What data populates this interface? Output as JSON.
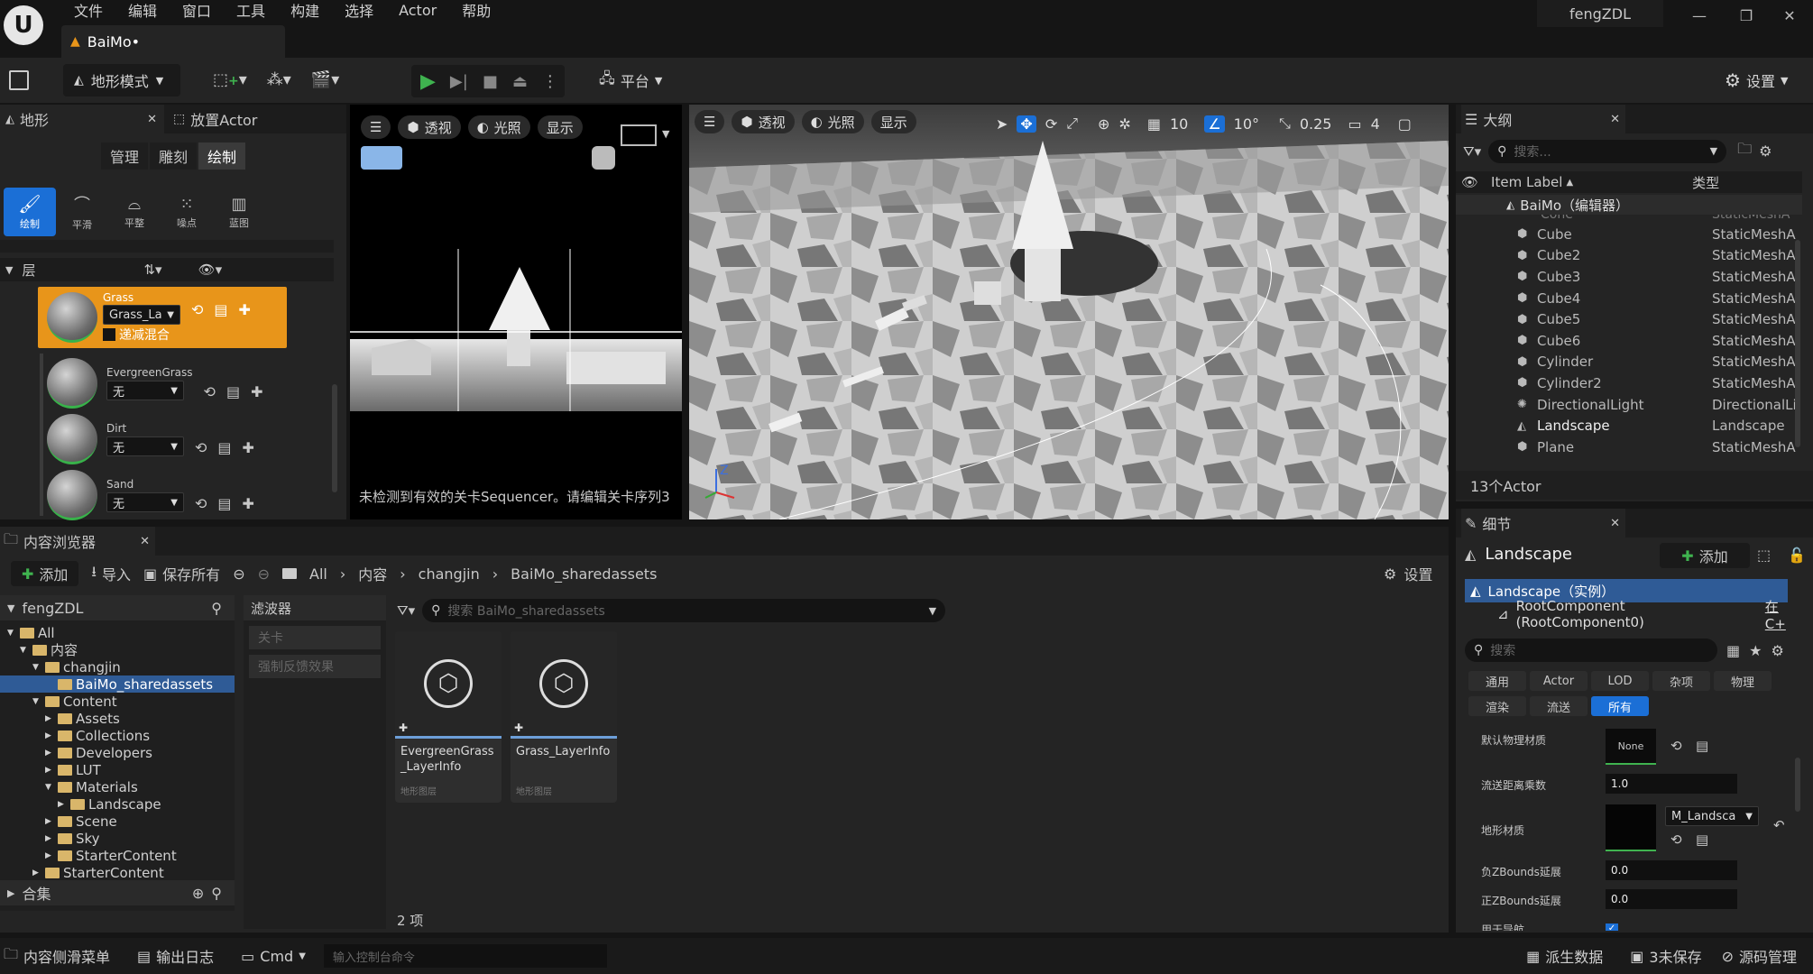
{
  "menu": [
    "文件",
    "编辑",
    "窗口",
    "工具",
    "构建",
    "选择",
    "Actor",
    "帮助"
  ],
  "document_tab": "BaiMo•",
  "user": "fengZDL",
  "window_controls": {
    "minimize": "—",
    "restore": "❐",
    "close": "✕"
  },
  "toolbar": {
    "mode": "地形模式",
    "platform": "平台",
    "settings": "设置"
  },
  "landscape_panel": {
    "tabs": [
      "地形",
      "放置Actor"
    ],
    "modes": [
      "管理",
      "雕刻",
      "绘制"
    ],
    "active_mode": "绘制",
    "tools": [
      "绘制",
      "平滑",
      "平整",
      "噪点",
      "蓝图"
    ],
    "layer_section": "层",
    "layers": [
      {
        "name": "Grass",
        "info": "Grass_La",
        "blend": "递减混合",
        "selected": true
      },
      {
        "name": "EvergreenGrass",
        "info": "无"
      },
      {
        "name": "Dirt",
        "info": "无"
      },
      {
        "name": "Sand",
        "info": "无"
      }
    ]
  },
  "viewport_left": {
    "buttons": [
      "透视",
      "光照",
      "显示"
    ],
    "message": "未检测到有效的关卡Sequencer。请编辑关卡序列3"
  },
  "viewport_main": {
    "buttons": [
      "透视",
      "光照",
      "显示"
    ],
    "grid": "10",
    "angle": "10°",
    "scale": "0.25",
    "camera_speed": "4"
  },
  "outliner": {
    "title": "大纲",
    "search_placeholder": "搜索...",
    "col_label": "Item Label",
    "col_type": "类型",
    "root": "BaiMo（编辑器）",
    "partial_row": {
      "name": "Cone",
      "type": "StaticMeshA"
    },
    "rows": [
      {
        "name": "Cube",
        "type": "StaticMeshA"
      },
      {
        "name": "Cube2",
        "type": "StaticMeshA"
      },
      {
        "name": "Cube3",
        "type": "StaticMeshA"
      },
      {
        "name": "Cube4",
        "type": "StaticMeshA"
      },
      {
        "name": "Cube5",
        "type": "StaticMeshA"
      },
      {
        "name": "Cube6",
        "type": "StaticMeshA"
      },
      {
        "name": "Cylinder",
        "type": "StaticMeshA"
      },
      {
        "name": "Cylinder2",
        "type": "StaticMeshA"
      },
      {
        "name": "DirectionalLight",
        "type": "DirectionalLi"
      },
      {
        "name": "Landscape",
        "type": "Landscape"
      },
      {
        "name": "Plane",
        "type": "StaticMeshA"
      }
    ],
    "count": "13个Actor"
  },
  "details": {
    "title": "细节",
    "object": "Landscape",
    "add": "添加",
    "instance": "Landscape（实例）",
    "component": "RootComponent (RootComponent0)",
    "component_edit": "在C+",
    "search_placeholder": "搜索",
    "filter_tabs_row1": [
      "通用",
      "Actor",
      "LOD",
      "杂项",
      "物理"
    ],
    "filter_tabs_row2": [
      "渲染",
      "流送",
      "所有"
    ],
    "props": [
      {
        "label": "默认物理材质",
        "value": "None"
      },
      {
        "label": "流送距离乘数",
        "value": "1.0"
      },
      {
        "label": "地形材质",
        "value": "M_Landsca"
      },
      {
        "label": "负ZBounds延展",
        "value": "0.0"
      },
      {
        "label": "正ZBounds延展",
        "value": "0.0"
      },
      {
        "label": "用于导航",
        "value": ""
      }
    ]
  },
  "content_browser": {
    "title": "内容浏览器",
    "add": "添加",
    "import": "导入",
    "save_all": "保存所有",
    "breadcrumb": [
      "All",
      "内容",
      "changjin",
      "BaiMo_sharedassets"
    ],
    "settings": "设置",
    "root": "fengZDL",
    "tree": [
      {
        "label": "All",
        "depth": 0,
        "open": true
      },
      {
        "label": "内容",
        "depth": 1,
        "open": true
      },
      {
        "label": "changjin",
        "depth": 2,
        "open": true
      },
      {
        "label": "BaiMo_sharedassets",
        "depth": 3,
        "selected": true
      },
      {
        "label": "Content",
        "depth": 2,
        "open": true
      },
      {
        "label": "Assets",
        "depth": 3
      },
      {
        "label": "Collections",
        "depth": 3
      },
      {
        "label": "Developers",
        "depth": 3
      },
      {
        "label": "LUT",
        "depth": 3
      },
      {
        "label": "Materials",
        "depth": 3,
        "open": true
      },
      {
        "label": "Landscape",
        "depth": 4
      },
      {
        "label": "Scene",
        "depth": 3
      },
      {
        "label": "Sky",
        "depth": 3
      },
      {
        "label": "StarterContent",
        "depth": 3
      },
      {
        "label": "StarterContent",
        "depth": 2
      }
    ],
    "collections": "合集",
    "filters_title": "滤波器",
    "filters": [
      "关卡",
      "强制反馈效果"
    ],
    "search_placeholder": "搜索 BaiMo_sharedassets",
    "assets": [
      {
        "name": "EvergreenGrass_LayerInfo",
        "type": "地形图层"
      },
      {
        "name": "Grass_LayerInfo",
        "type": "地形图层"
      }
    ],
    "item_count": "2 项"
  },
  "bottom_bar": {
    "drawer": "内容侧滑菜单",
    "output_log": "输出日志",
    "cmd": "Cmd",
    "console_placeholder": "输入控制台命令",
    "derived": "派生数据",
    "unsaved": "3未保存",
    "source": "源码管理"
  },
  "colors": {
    "accent": "#1b6fd6",
    "selected_layer": "#e8951a",
    "play": "#3fb34f"
  }
}
